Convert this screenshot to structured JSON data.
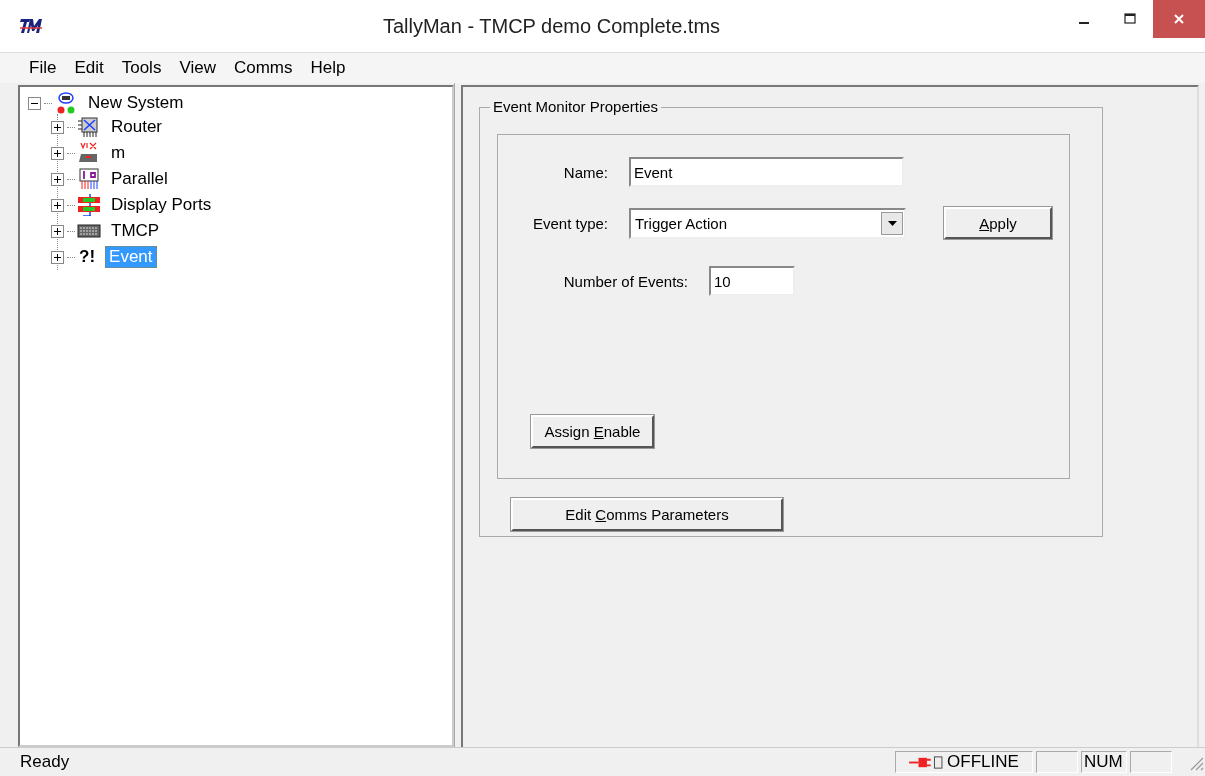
{
  "window": {
    "title": "TallyMan - TMCP demo Complete.tms"
  },
  "menu": [
    "File",
    "Edit",
    "Tools",
    "View",
    "Comms",
    "Help"
  ],
  "tree": [
    {
      "label": "New System",
      "kind": "system",
      "expanded": true,
      "selected": false,
      "children": [
        {
          "label": "Router",
          "kind": "router",
          "expanded": false,
          "selected": false
        },
        {
          "label": "m",
          "kind": "mixer",
          "expanded": false,
          "selected": false
        },
        {
          "label": "Parallel",
          "kind": "parallel",
          "expanded": false,
          "selected": false
        },
        {
          "label": "Display Ports",
          "kind": "display",
          "expanded": false,
          "selected": false
        },
        {
          "label": "TMCP",
          "kind": "keyboard",
          "expanded": false,
          "selected": false
        },
        {
          "label": "Event",
          "kind": "event",
          "icon_text": "?!",
          "expanded": false,
          "selected": true
        }
      ]
    }
  ],
  "properties": {
    "title": "Event Monitor Properties",
    "name": {
      "label": "Name:",
      "value": "Event"
    },
    "event_type": {
      "label": "Event type:",
      "value": "Trigger Action"
    },
    "apply_button": {
      "key": "A",
      "after": "pply"
    },
    "number_of_events": {
      "label": "Number of Events:",
      "value": "10"
    },
    "assign_button": {
      "before": "Assign ",
      "key": "E",
      "after": "nable"
    },
    "comms_button": {
      "before": "Edit ",
      "key": "C",
      "after": "omms Parameters"
    }
  },
  "status_bar": {
    "text": "Ready",
    "connection": "OFFLINE",
    "indicator": "NUM"
  }
}
